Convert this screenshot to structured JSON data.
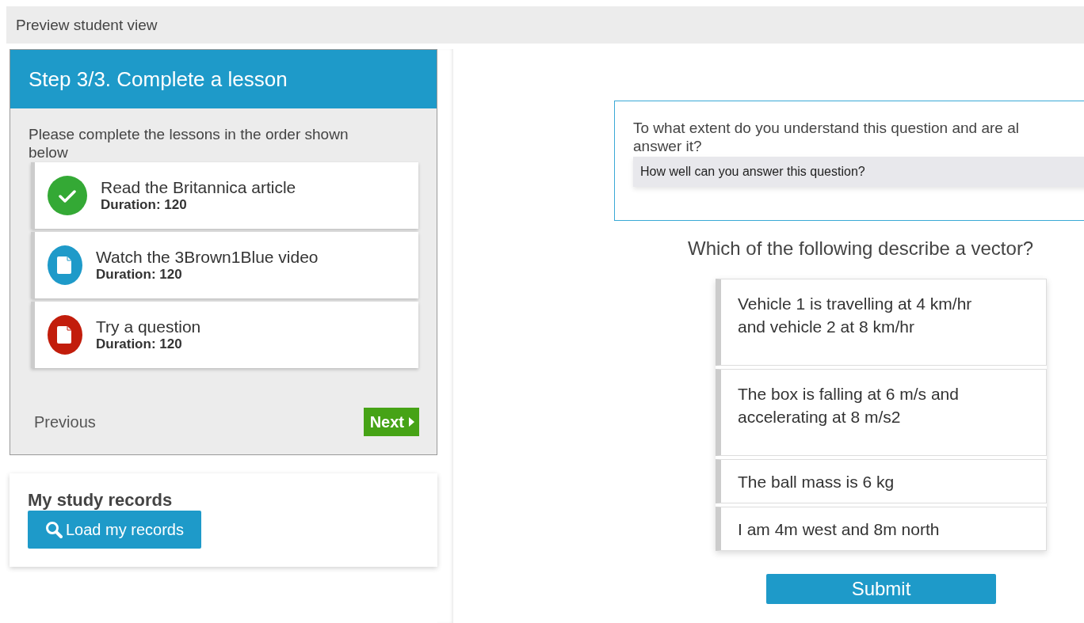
{
  "top_bar": {
    "title": "Preview student view"
  },
  "step_panel": {
    "title": "Step 3/3. Complete a lesson",
    "instructions": "Please complete the lessons in the order shown below",
    "lessons": [
      {
        "title": "Read the Britannica article",
        "duration": "Duration: 120",
        "kind": "check",
        "color": "#34a935"
      },
      {
        "title": "Watch the 3Brown1Blue video",
        "duration": "Duration: 120",
        "kind": "document",
        "color": "#1e9ac9"
      },
      {
        "title": "Try a question",
        "duration": "Duration: 120",
        "kind": "document",
        "color": "#c21d0c"
      }
    ],
    "previous_label": "Previous",
    "next_label": "Next"
  },
  "records_panel": {
    "title": "My study records",
    "button": "Load my records"
  },
  "question": {
    "confidence_prompt_lines": [
      "To what extent do you understand this question and are al",
      "answer it?"
    ],
    "confidence_field": "How well can you answer this question?",
    "prompt": "Which of the following describe a vector?",
    "options": [
      {
        "text": "Vehicle 1 is travelling at 4 km/hr and vehicle 2 at 8 km/hr",
        "selected": false
      },
      {
        "text": "The box is falling at 6 m/s and accelerating at 8 m/s2",
        "selected": false
      },
      {
        "text": "The ball mass is 6 kg",
        "selected": false
      },
      {
        "text": "I am 4m west and 8m north",
        "selected": false
      }
    ],
    "submit": "Submit"
  }
}
